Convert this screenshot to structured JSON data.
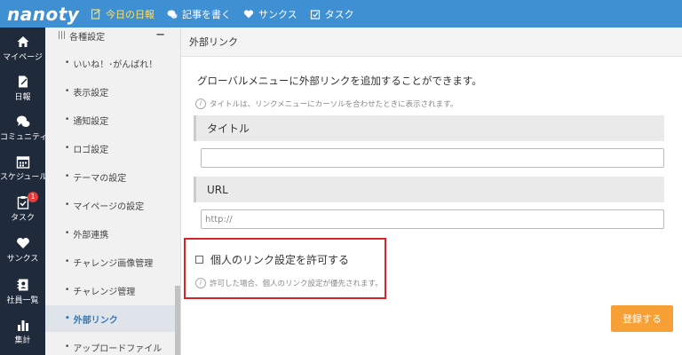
{
  "app": {
    "logo": "nanoty"
  },
  "topnav": {
    "items": [
      {
        "label": "今日の日報",
        "icon": "daily-report-icon",
        "active": true
      },
      {
        "label": "記事を書く",
        "icon": "comment-bubbles-icon"
      },
      {
        "label": "サンクス",
        "icon": "heart-icon"
      },
      {
        "label": "タスク",
        "icon": "task-check-icon"
      }
    ]
  },
  "sidebar": {
    "items": [
      {
        "label": "マイページ",
        "icon": "home-icon"
      },
      {
        "label": "日報",
        "icon": "edit-document-icon"
      },
      {
        "label": "コミュニティ",
        "icon": "community-icon"
      },
      {
        "label": "スケジュール",
        "icon": "calendar-icon"
      },
      {
        "label": "タスク",
        "icon": "task-clipboard-icon",
        "badge": "1"
      },
      {
        "label": "サンクス",
        "icon": "heart-icon"
      },
      {
        "label": "社員一覧",
        "icon": "address-book-icon"
      },
      {
        "label": "集計",
        "icon": "bar-chart-icon"
      }
    ]
  },
  "settings_menu": {
    "header": "各種設定",
    "items": [
      {
        "label": "いいね！･がんばれ！"
      },
      {
        "label": "表示設定"
      },
      {
        "label": "通知設定"
      },
      {
        "label": "ロゴ設定"
      },
      {
        "label": "テーマの設定"
      },
      {
        "label": "マイページの設定"
      },
      {
        "label": "外部連携"
      },
      {
        "label": "チャレンジ画像管理"
      },
      {
        "label": "チャレンジ管理"
      },
      {
        "label": "外部リンク",
        "active": true
      },
      {
        "label": "アップロードファイル"
      }
    ]
  },
  "main": {
    "title": "外部リンク",
    "description": "グローバルメニューに外部リンクを追加することができます。",
    "title_hint": "タイトルは、リンクメニューにカーソルを合わせたときに表示されます。",
    "fields": {
      "title_label": "タイトル",
      "title_value": "",
      "url_label": "URL",
      "url_placeholder": "http://"
    },
    "allow_personal_label": "個人のリンク設定を許可する",
    "allow_personal_checked": false,
    "allow_personal_hint": "許可した場合、個人のリンク設定が優先されます。",
    "save_label": "登録する"
  },
  "colors": {
    "topbar": "#3f8fd3",
    "sidebar": "#1f2a3b",
    "active_link": "#2d78c4",
    "save_button": "#f7a035",
    "highlight_box": "#d9232a",
    "badge": "#e43b3b"
  }
}
